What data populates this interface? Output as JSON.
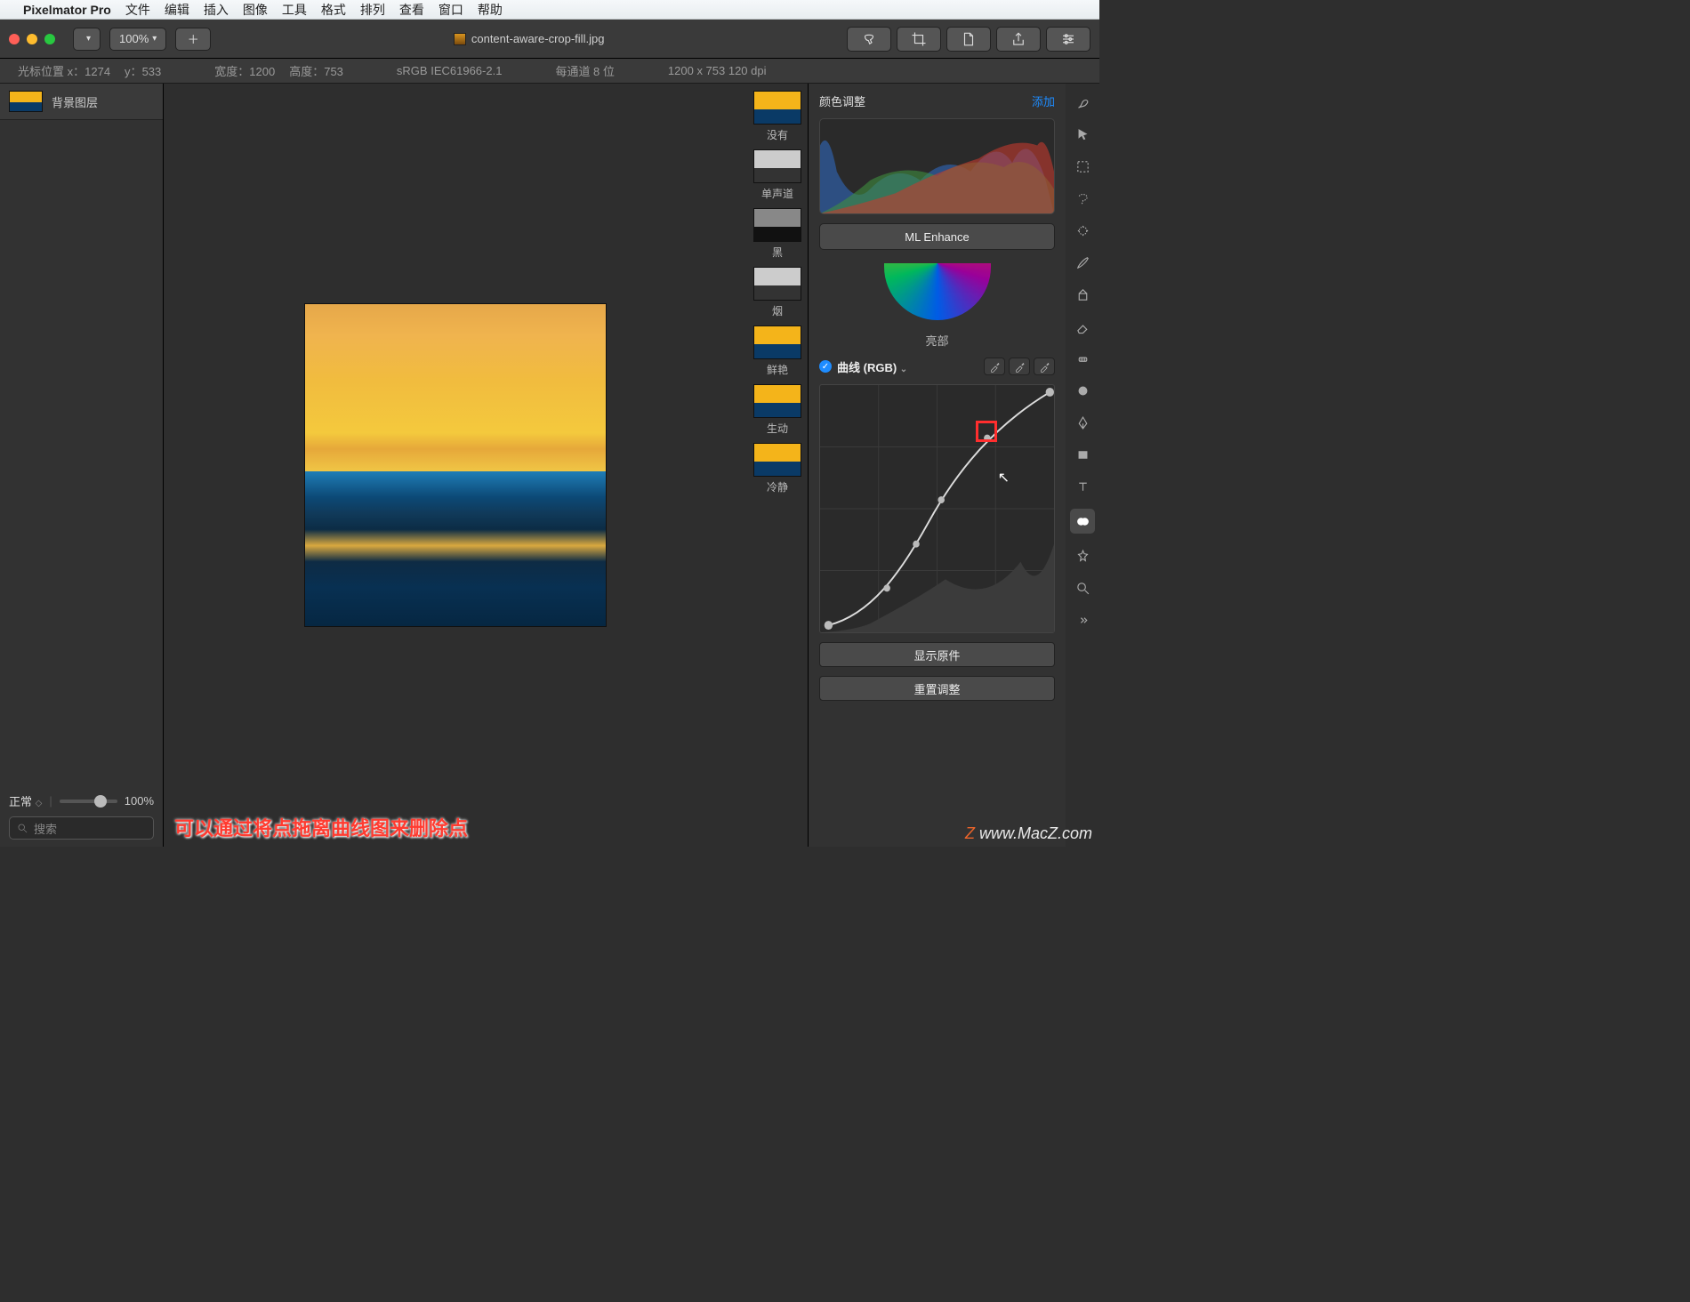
{
  "menubar": {
    "app": "Pixelmator Pro",
    "items": [
      "文件",
      "编辑",
      "插入",
      "图像",
      "工具",
      "格式",
      "排列",
      "查看",
      "窗口",
      "帮助"
    ]
  },
  "titlebar": {
    "zoom": "100%",
    "filename": "content-aware-crop-fill.jpg"
  },
  "infostrip": {
    "cursor_label": "光标位置 x：",
    "cursor_x": "1274",
    "cursor_y_label": "y：",
    "cursor_y": "533",
    "width_label": "宽度：",
    "width": "1200",
    "height_label": "高度：",
    "height": "753",
    "colorspace": "sRGB IEC61966-2.1",
    "bits": "每通道 8 位",
    "dims": "1200 x 753 120 dpi"
  },
  "layers": {
    "layer0": "背景图层",
    "blend_mode": "正常",
    "opacity": "100%",
    "search_placeholder": "搜索"
  },
  "presets": {
    "p0": "没有",
    "p1": "单声道",
    "p2": "黑",
    "p3": "烟",
    "p4": "鲜艳",
    "p5": "生动",
    "p6": "冷静"
  },
  "adjust": {
    "title": "颜色调整",
    "add": "添加",
    "ml": "ML Enhance",
    "highlights": "亮部",
    "curves_name": "曲线 (RGB)",
    "show_original": "显示原件",
    "reset": "重置调整"
  },
  "overlay_tip": "可以通过将点拖离曲线图来删除点",
  "watermark": "www.MacZ.com"
}
